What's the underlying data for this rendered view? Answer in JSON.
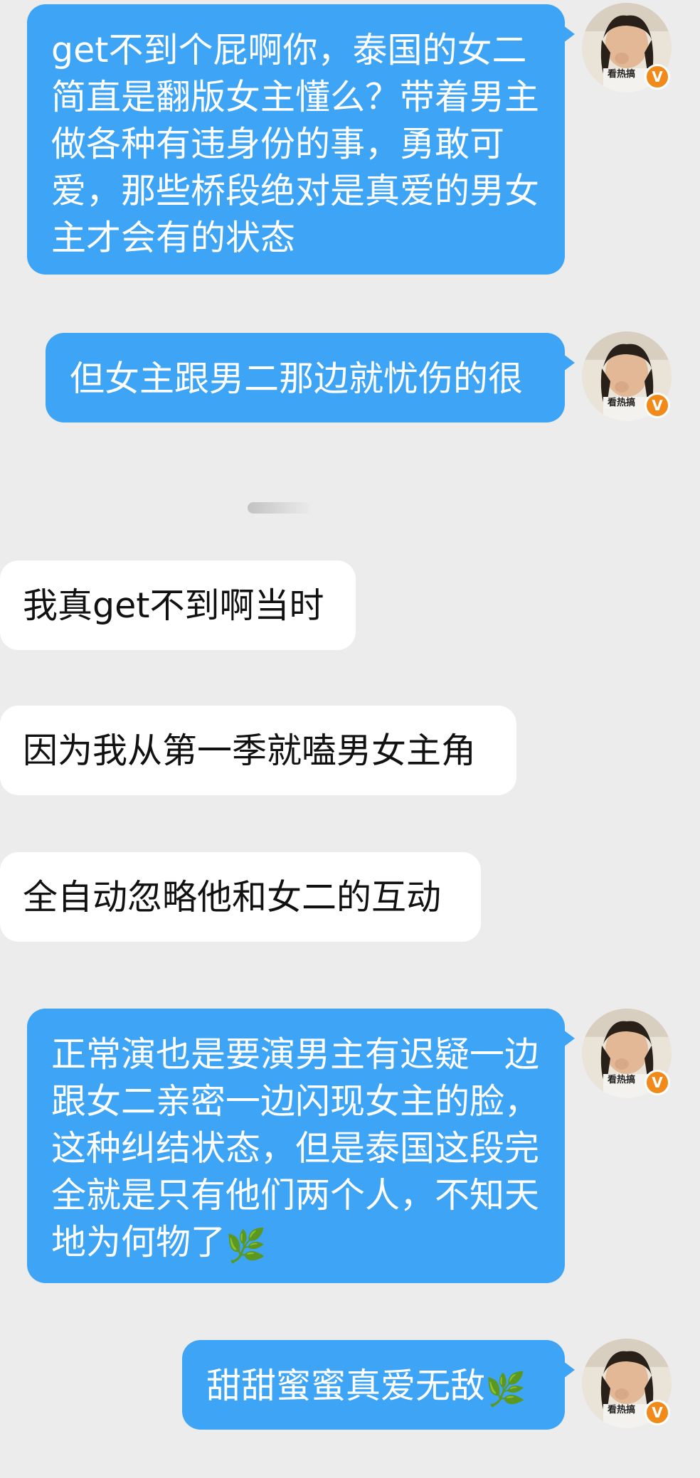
{
  "messages": [
    {
      "direction": "outgoing",
      "text": "get不到个屁啊你，泰国的女二简直是翻版女主懂么？带着男主做各种有违身份的事，勇敢可爱，那些桥段绝对是真爱的男女主才会有的状态",
      "emoji": ""
    },
    {
      "direction": "outgoing",
      "text": "但女主跟男二那边就忧伤的很",
      "emoji": ""
    },
    {
      "direction": "incoming",
      "text": "我真get不到啊当时",
      "emoji": ""
    },
    {
      "direction": "incoming",
      "text": "因为我从第一季就嗑男女主角",
      "emoji": ""
    },
    {
      "direction": "incoming",
      "text": "全自动忽略他和女二的互动",
      "emoji": ""
    },
    {
      "direction": "outgoing",
      "text": "正常演也是要演男主有迟疑一边跟女二亲密一边闪现女主的脸，这种纠结状态，但是泰国这段完全就是只有他们两个人，不知天地为何物了",
      "emoji": "🌿"
    },
    {
      "direction": "outgoing",
      "text": "甜甜蜜蜜真爱无敌",
      "emoji": "🌿"
    }
  ],
  "avatar": {
    "caption": "看热搞",
    "verified_badge": "V",
    "icon": "user-avatar-photo"
  },
  "colors": {
    "background": "#ececec",
    "outgoing_bubble": "#3ea4f6",
    "incoming_bubble": "#ffffff",
    "badge": "#f28a1a"
  }
}
